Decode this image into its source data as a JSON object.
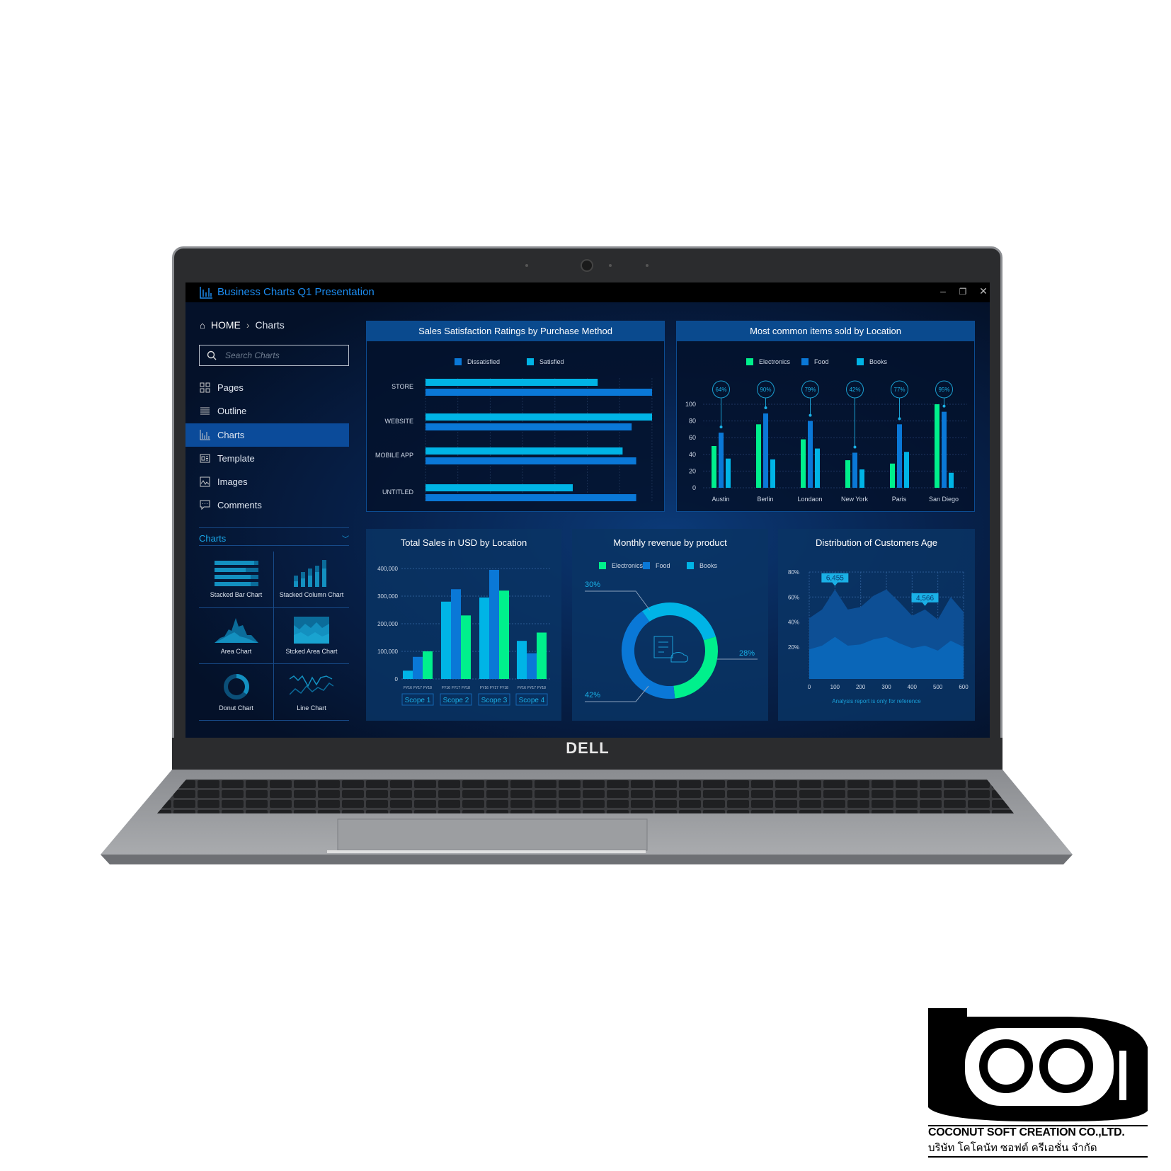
{
  "window": {
    "title": "Business Charts Q1 Presentation",
    "controls": [
      "minimize",
      "restore",
      "close"
    ]
  },
  "breadcrumb": {
    "home": "HOME",
    "current": "Charts"
  },
  "search": {
    "placeholder": "Search Charts"
  },
  "nav": [
    {
      "label": "Pages",
      "icon": "grid-icon"
    },
    {
      "label": "Outline",
      "icon": "list-icon"
    },
    {
      "label": "Charts",
      "icon": "bar-chart-icon",
      "active": true
    },
    {
      "label": "Template",
      "icon": "template-icon"
    },
    {
      "label": "Images",
      "icon": "image-icon"
    },
    {
      "label": "Comments",
      "icon": "comment-icon"
    }
  ],
  "charts_section": {
    "title": "Charts",
    "tiles": [
      "Stacked Bar Chart",
      "Stacked Column Chart",
      "Area Chart",
      "Stcked Area Chart",
      "Donut Chart",
      "Line Chart"
    ]
  },
  "device": {
    "brand": "DELL"
  },
  "watermark": {
    "line1": "COCONUT SOFT CREATION CO.,LTD.",
    "line2": "บริษัท โคโคนัท ซอฟต์ ครีเอชั่น จำกัด"
  },
  "colors": {
    "electronics": "#00f08c",
    "food": "#0a78d7",
    "books": "#00b4e6",
    "accent": "#1c8cf0"
  },
  "chart_data": [
    {
      "type": "bar",
      "orientation": "horizontal",
      "title": "Sales Satisfaction Ratings by Purchase Method",
      "categories": [
        "STORE",
        "WEBSITE",
        "MOBILE APP",
        "UNTITLED"
      ],
      "series": [
        {
          "name": "Dissatisfied",
          "values": [
            100,
            91,
            93,
            93
          ]
        },
        {
          "name": "Satisfied",
          "values": [
            76,
            100,
            87,
            65
          ]
        }
      ],
      "legend": "top",
      "grid": true
    },
    {
      "type": "bar",
      "title": "Most common items sold by Location",
      "categories": [
        "Austin",
        "Berlin",
        "Londaon",
        "New York",
        "Paris",
        "San Diego"
      ],
      "series": [
        {
          "name": "Electronics",
          "values": [
            50,
            76,
            58,
            33,
            29,
            100
          ]
        },
        {
          "name": "Food",
          "values": [
            66,
            89,
            80,
            42,
            76,
            91
          ]
        },
        {
          "name": "Books",
          "values": [
            35,
            34,
            47,
            22,
            43,
            18
          ]
        }
      ],
      "annotations": [
        "64%",
        "90%",
        "79%",
        "42%",
        "77%",
        "95%"
      ],
      "yticks": [
        "0",
        "20",
        "40",
        "60",
        "80",
        "100"
      ],
      "ylim": [
        0,
        100
      ],
      "legend": "top",
      "grid": true
    },
    {
      "type": "bar",
      "title": "Total Sales in USD by Location",
      "categories": [
        "Scope 1",
        "Scope 2",
        "Scope 3",
        "Scope 4"
      ],
      "subcategories": [
        "FY16",
        "FY17",
        "FY18"
      ],
      "values": [
        [
          30000,
          80000,
          100000
        ],
        [
          280000,
          325000,
          230000
        ],
        [
          295000,
          395000,
          320000
        ],
        [
          138000,
          93000,
          168000
        ]
      ],
      "yticks": [
        "0",
        "100,000",
        "200,000",
        "300,000",
        "400,000"
      ],
      "ylim": [
        0,
        400000
      ],
      "grid": true
    },
    {
      "type": "pie",
      "donut": true,
      "title": "Monthly revenue by product",
      "slices": [
        {
          "name": "Books",
          "value": 30,
          "label": "30%"
        },
        {
          "name": "Electronics",
          "value": 28,
          "label": "28%"
        },
        {
          "name": "Food",
          "value": 42,
          "label": "42%"
        }
      ],
      "legend_order": [
        "Electronics",
        "Food",
        "Books"
      ],
      "legend": "top"
    },
    {
      "type": "area",
      "title": "Distribution of Customers Age",
      "x": [
        0,
        50,
        100,
        150,
        200,
        250,
        300,
        350,
        400,
        450,
        500,
        550,
        600
      ],
      "series": [
        {
          "values": [
            43,
            50,
            66,
            50,
            52,
            61,
            66,
            56,
            45,
            50,
            42,
            60,
            48
          ]
        },
        {
          "values": [
            18,
            21,
            28,
            21,
            22,
            26,
            28,
            23,
            19,
            21,
            17,
            25,
            20
          ]
        }
      ],
      "xticks": [
        "0",
        "100",
        "200",
        "300",
        "400",
        "500",
        "600"
      ],
      "yticks": [
        "20%",
        "40%",
        "60%",
        "80%"
      ],
      "ylim": [
        0,
        80
      ],
      "annotations": [
        {
          "x": 100,
          "label": "6,455"
        },
        {
          "x": 450,
          "label": "4,566"
        }
      ],
      "footnote": "Analysis report is only for reference",
      "grid": true
    }
  ]
}
